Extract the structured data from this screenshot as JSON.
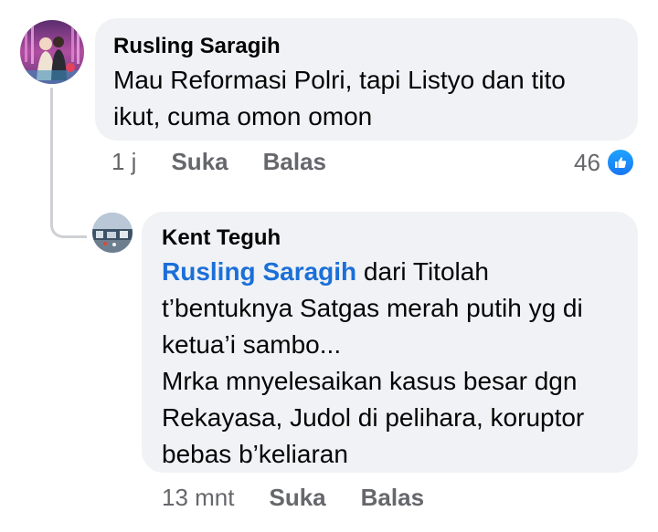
{
  "comments": [
    {
      "author": "Rusling Saragih",
      "text_lines": [
        "Mau Reformasi Polri, tapi Listyo dan tito",
        "ikut, cuma omon omon"
      ],
      "time": "1 j",
      "like_label": "Suka",
      "reply_label": "Balas",
      "reaction_count": "46",
      "reaction_icon": "like-icon"
    },
    {
      "author": "Kent Teguh",
      "mention": "Rusling Saragih",
      "text_lines": [
        " dari Titolah",
        "t’bentuknya Satgas merah putih yg di",
        "ketua’i sambo...",
        "Mrka mnyelesaikan kasus besar dgn",
        "Rekayasa, Judol di pelihara, koruptor",
        "bebas b’keliaran"
      ],
      "time": "13 mnt",
      "like_label": "Suka",
      "reply_label": "Balas"
    }
  ],
  "colors": {
    "bubble": "#f0f2f5",
    "mention": "#1b6fd8",
    "meta": "#65676b",
    "like_badge": "#1877f2",
    "thread_line": "#ced0d4"
  }
}
